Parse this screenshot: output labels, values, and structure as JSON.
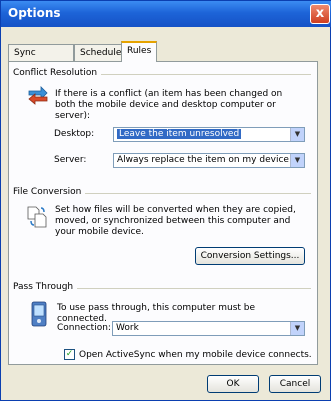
{
  "window": {
    "title": "Options",
    "close_glyph": "x"
  },
  "tabs": [
    {
      "label": "Sync Options"
    },
    {
      "label": "Schedule"
    },
    {
      "label": "Rules"
    }
  ],
  "conflict": {
    "group_label": "Conflict Resolution",
    "description": "If there is a conflict (an item has been changed on both the mobile device and desktop computer or server):",
    "desktop_label": "Desktop:",
    "desktop_value": "Leave the item unresolved",
    "server_label": "Server:",
    "server_value": "Always replace the item on my device"
  },
  "conversion": {
    "group_label": "File Conversion",
    "description": "Set how files will be converted when they are copied, moved, or synchronized between this computer and your mobile device.",
    "settings_button": "Conversion Settings..."
  },
  "passthrough": {
    "group_label": "Pass Through",
    "description": "To use pass through, this computer must be connected.",
    "connection_label": "Connection:",
    "connection_value": "Work",
    "checkbox_label": "Open ActiveSync when my mobile device connects.",
    "checkbox_checked": true
  },
  "footer": {
    "ok": "OK",
    "cancel": "Cancel"
  }
}
